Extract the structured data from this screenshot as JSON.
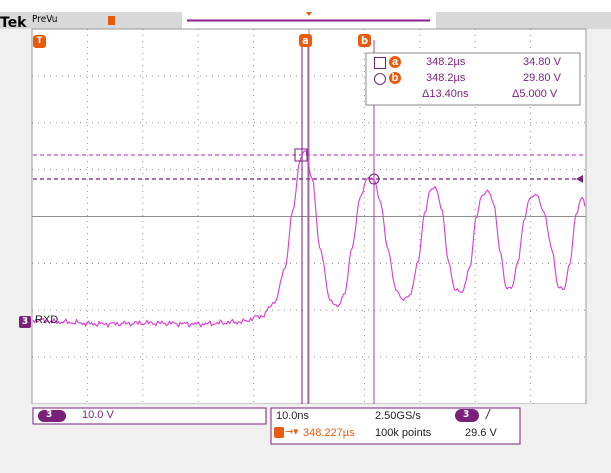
{
  "header": {
    "brand": "Tek",
    "mode": "PreVu"
  },
  "cursor_readout": {
    "row_a": {
      "label": "a",
      "time": "348.2µs",
      "voltage": "34.80 V"
    },
    "row_b": {
      "label": "b",
      "time": "348.2µs",
      "voltage": "29.80 V"
    },
    "delta": {
      "time": "Δ13.40ns",
      "voltage": "Δ5.000 V"
    }
  },
  "cursor_markers": {
    "a": "a",
    "b": "b"
  },
  "trigger_marker": "T",
  "channel": {
    "number": "3",
    "label": "RXD",
    "scale": "10.0 V"
  },
  "timebase": {
    "horizontal_scale": "10.0ns",
    "sample_rate": "2.50GS/s",
    "trigger_position": "348.227µs",
    "record_length": "100k points"
  },
  "trigger": {
    "source": "3",
    "slope": "/",
    "level": "29.6 V"
  },
  "colors": {
    "background": "#ffffff",
    "grid": "#909090",
    "waveform": "#d83ad8",
    "cursor": "#7a1f7a",
    "marker": "#ea5a0c",
    "channel_badge": "#7a1f7a",
    "header_bg": "#d8d8d8"
  }
}
